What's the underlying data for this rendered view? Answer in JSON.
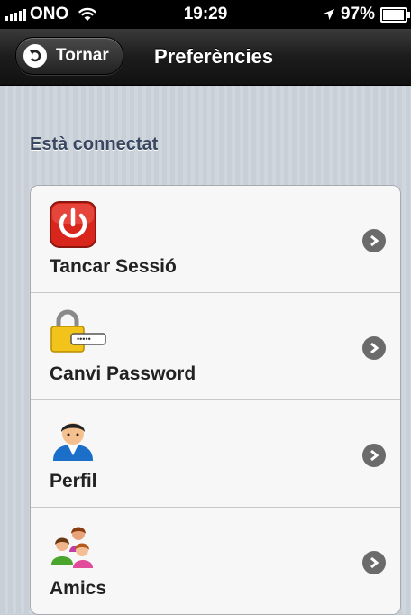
{
  "status_bar": {
    "carrier": "ONO",
    "time": "19:29",
    "battery": "97%",
    "battery_level": 0.97
  },
  "nav": {
    "back_label": "Tornar",
    "title": "Preferències"
  },
  "section": {
    "header": "Està connectat"
  },
  "items": [
    {
      "label": "Tancar Sessió",
      "icon": "power-icon"
    },
    {
      "label": "Canvi Password",
      "icon": "padlock-key-icon"
    },
    {
      "label": "Perfil",
      "icon": "user-profile-icon"
    },
    {
      "label": "Amics",
      "icon": "friends-group-icon"
    }
  ],
  "colors": {
    "nav_bar": "#1c1c1c",
    "background": "#c8cfd7",
    "section_header": "#394760",
    "chevron": "#6b6b6b",
    "power_red": "#d9261c"
  }
}
